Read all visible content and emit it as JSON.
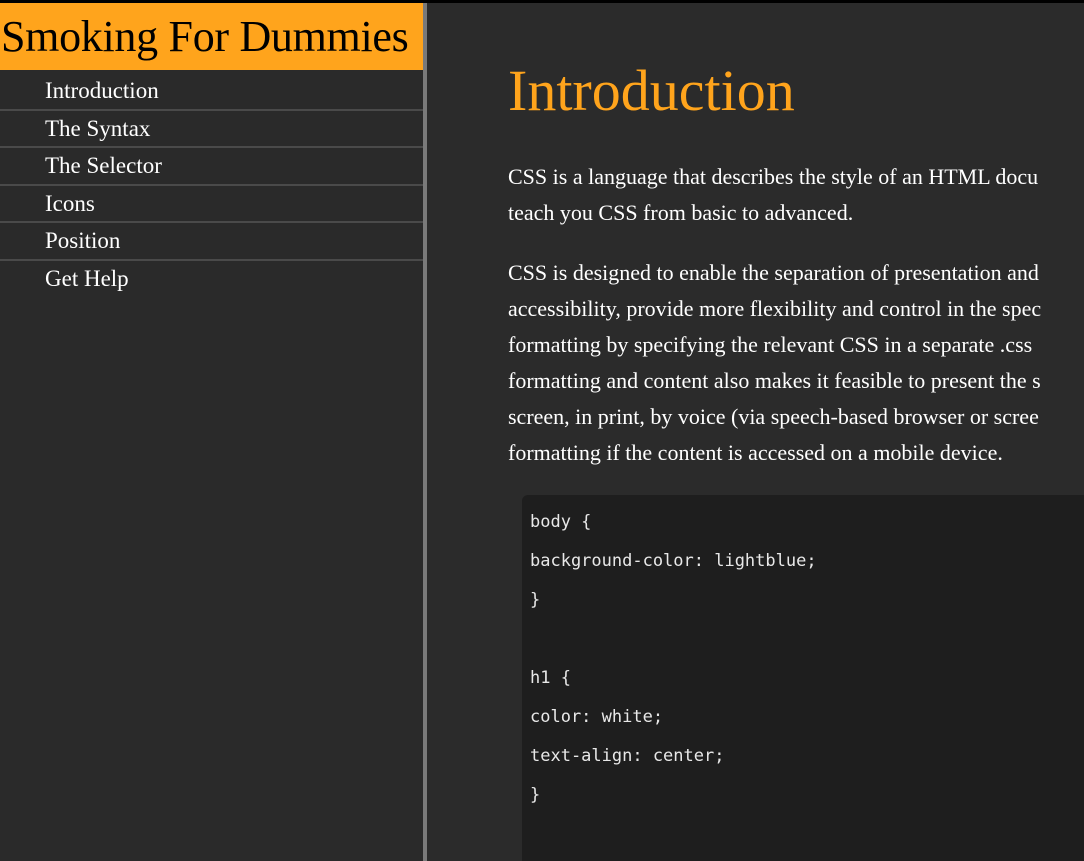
{
  "brand": {
    "title": "Smoking For Dummies"
  },
  "sidebar": {
    "items": [
      {
        "label": "Introduction"
      },
      {
        "label": "The Syntax"
      },
      {
        "label": "The Selector"
      },
      {
        "label": "Icons"
      },
      {
        "label": "Position"
      },
      {
        "label": "Get Help"
      }
    ]
  },
  "main": {
    "title": "Introduction",
    "paragraph1": [
      "CSS is a language that describes the style of an HTML docu",
      "teach you CSS from basic to advanced."
    ],
    "paragraph2": [
      "CSS is designed to enable the separation of presentation and",
      "accessibility, provide more flexibility and control in the spec",
      "formatting by specifying the relevant CSS in a separate .css",
      "formatting and content also makes it feasible to present the s",
      "screen, in print, by voice (via speech-based browser or scree",
      "formatting if the content is accessed on a mobile device."
    ],
    "code": [
      "body {",
      "background-color: lightblue;",
      "}",
      "",
      "h1 {",
      "color: white;",
      "text-align: center;",
      "}"
    ]
  },
  "colors": {
    "accent": "#ffa41c",
    "sidebar_bg": "#2a2a2a",
    "main_bg": "#2b2b2b",
    "code_bg": "#1e1e1e",
    "text": "#ffffff"
  }
}
